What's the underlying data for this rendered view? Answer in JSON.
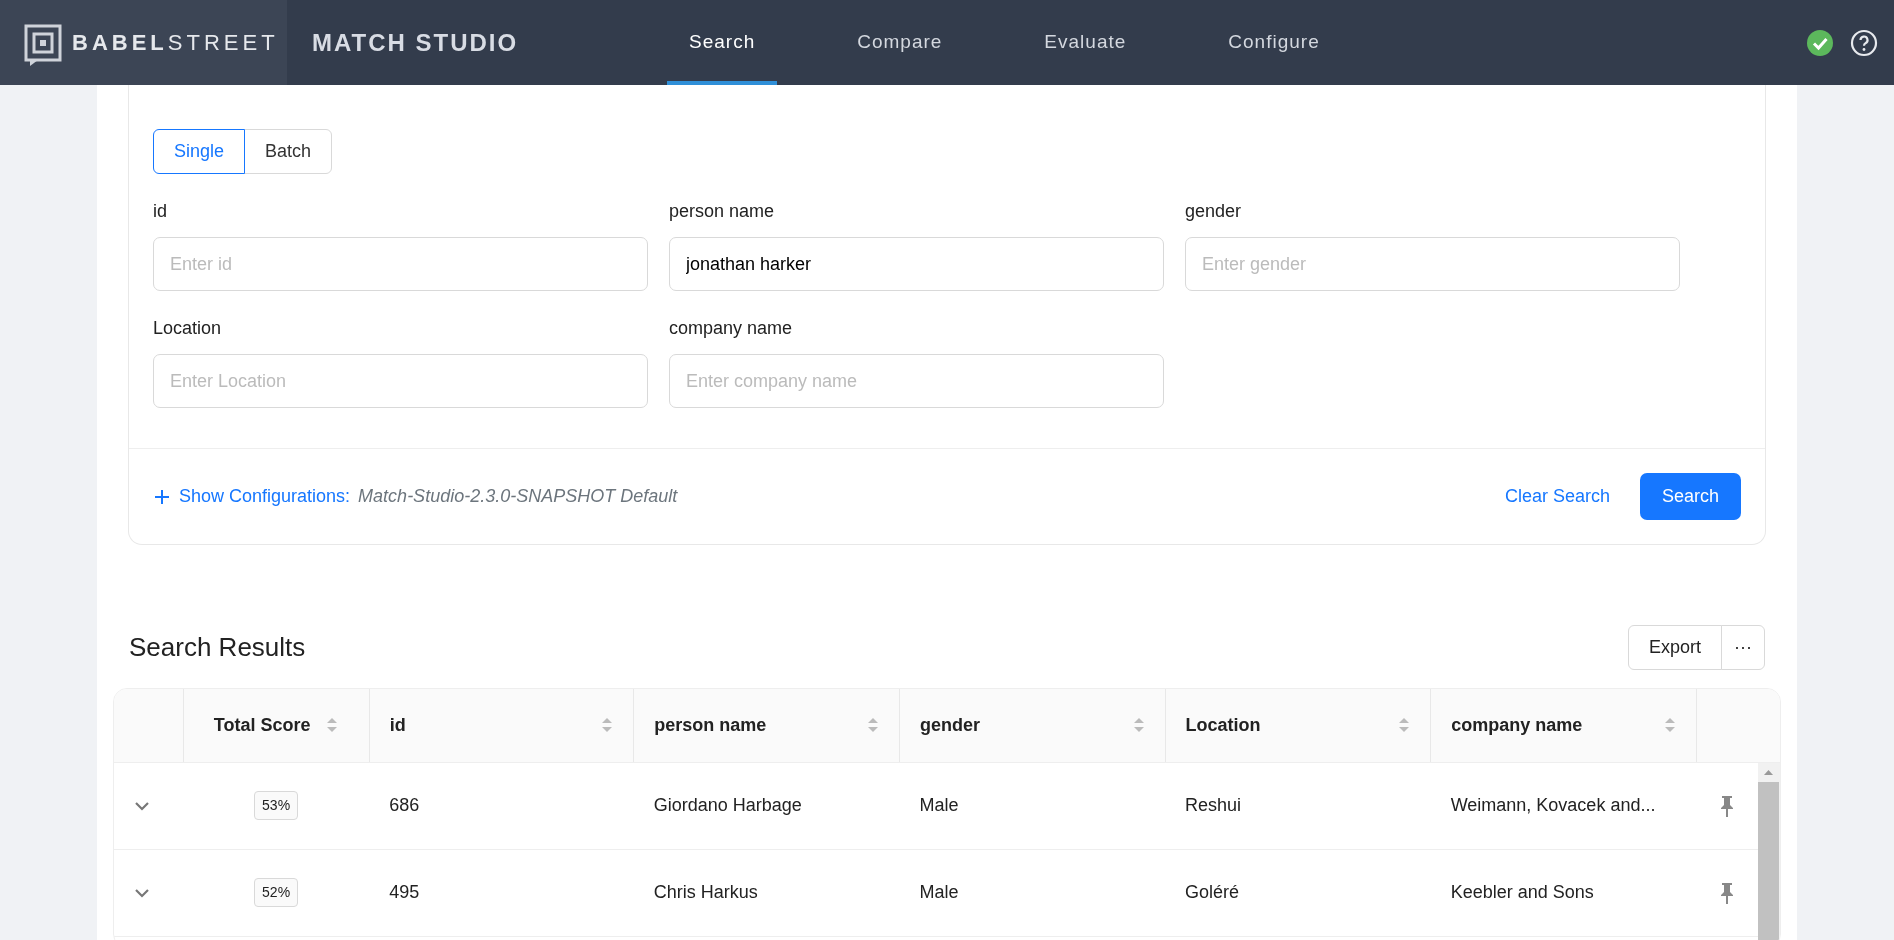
{
  "header": {
    "logo_bold": "BABEL",
    "logo_light": "STREET",
    "app_title": "MATCH STUDIO",
    "nav": [
      {
        "label": "Search",
        "selected": true
      },
      {
        "label": "Compare",
        "selected": false
      },
      {
        "label": "Evaluate",
        "selected": false
      },
      {
        "label": "Configure",
        "selected": false
      }
    ]
  },
  "mode_tabs": [
    {
      "label": "Single",
      "selected": true
    },
    {
      "label": "Batch",
      "selected": false
    }
  ],
  "fields": [
    {
      "label": "id",
      "placeholder": "Enter id"
    },
    {
      "label": "person name",
      "value": "jonathan harker"
    },
    {
      "label": "gender",
      "placeholder": "Enter gender"
    },
    {
      "label": "Location",
      "placeholder": "Enter Location"
    },
    {
      "label": "company name",
      "placeholder": "Enter company name"
    }
  ],
  "config": {
    "link": "Show Configurations:",
    "value": "Match-Studio-2.3.0-SNAPSHOT Default"
  },
  "clear_button": "Clear Search",
  "search_button": "Search",
  "results": {
    "title": "Search Results",
    "export_button": "Export",
    "more_button": "···",
    "columns": [
      "Total Score",
      "id",
      "person name",
      "gender",
      "Location",
      "company name"
    ],
    "rows": [
      {
        "cells": [
          "53%",
          "686",
          "Giordano Harbage",
          "Male",
          "Reshui",
          "Weimann, Kovacek and..."
        ]
      },
      {
        "cells": [
          "52%",
          "495",
          "Chris Harkus",
          "Male",
          "Goléré",
          "Keebler and Sons"
        ]
      }
    ]
  }
}
